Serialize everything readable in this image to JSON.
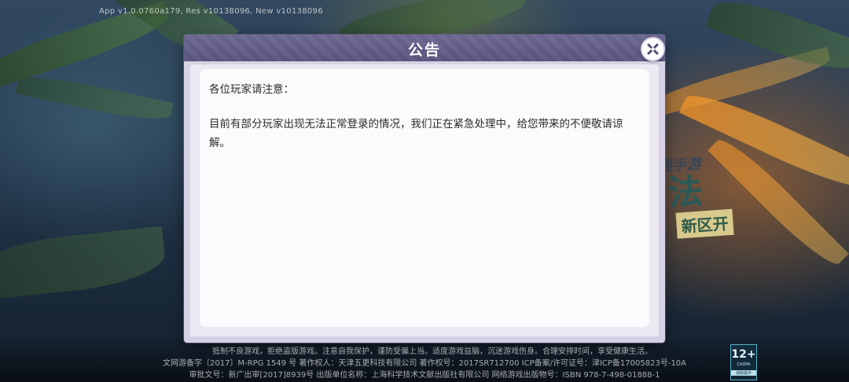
{
  "version_info": "App v1.0.0760a179, Res v10138096, New v10138096",
  "promo": {
    "line1": "最手游",
    "line2": "法",
    "line3": "新区开"
  },
  "dialog": {
    "title": "公告",
    "greeting": "各位玩家请注意：",
    "body": "目前有部分玩家出现无法正常登录的情况，我们正在紧急处理中，给您带来的不便敬请谅解。"
  },
  "footer": {
    "line1": "抵制不良游戏，拒绝盗版游戏。注意自我保护，谨防受骗上当。适度游戏益脑，沉迷游戏伤身。合理安排时间，享受健康生活。",
    "line2": "文网游备字〔2017〕M-RPG 1549 号 著作权人：天津五更科技有限公司 著作权号：2017SR712700 ICP备案/许可证号：津ICP备17005823号-10A",
    "line3": "审批文号：新广出审[2017]8939号 出版单位名称：上海科学技术文献出版社有限公司 网络游戏出版物号：ISBN 978-7-498-01888-1"
  },
  "age_rating": {
    "value": "12+",
    "sub": "CADPA",
    "tag": "适龄提示"
  },
  "colors": {
    "header": "#5f5b87",
    "dialog_frame": "#d6d1e4",
    "content_bg": "#fbfbfd",
    "text": "#2b2b2b"
  },
  "icons": {
    "close": "close-x-icon"
  }
}
